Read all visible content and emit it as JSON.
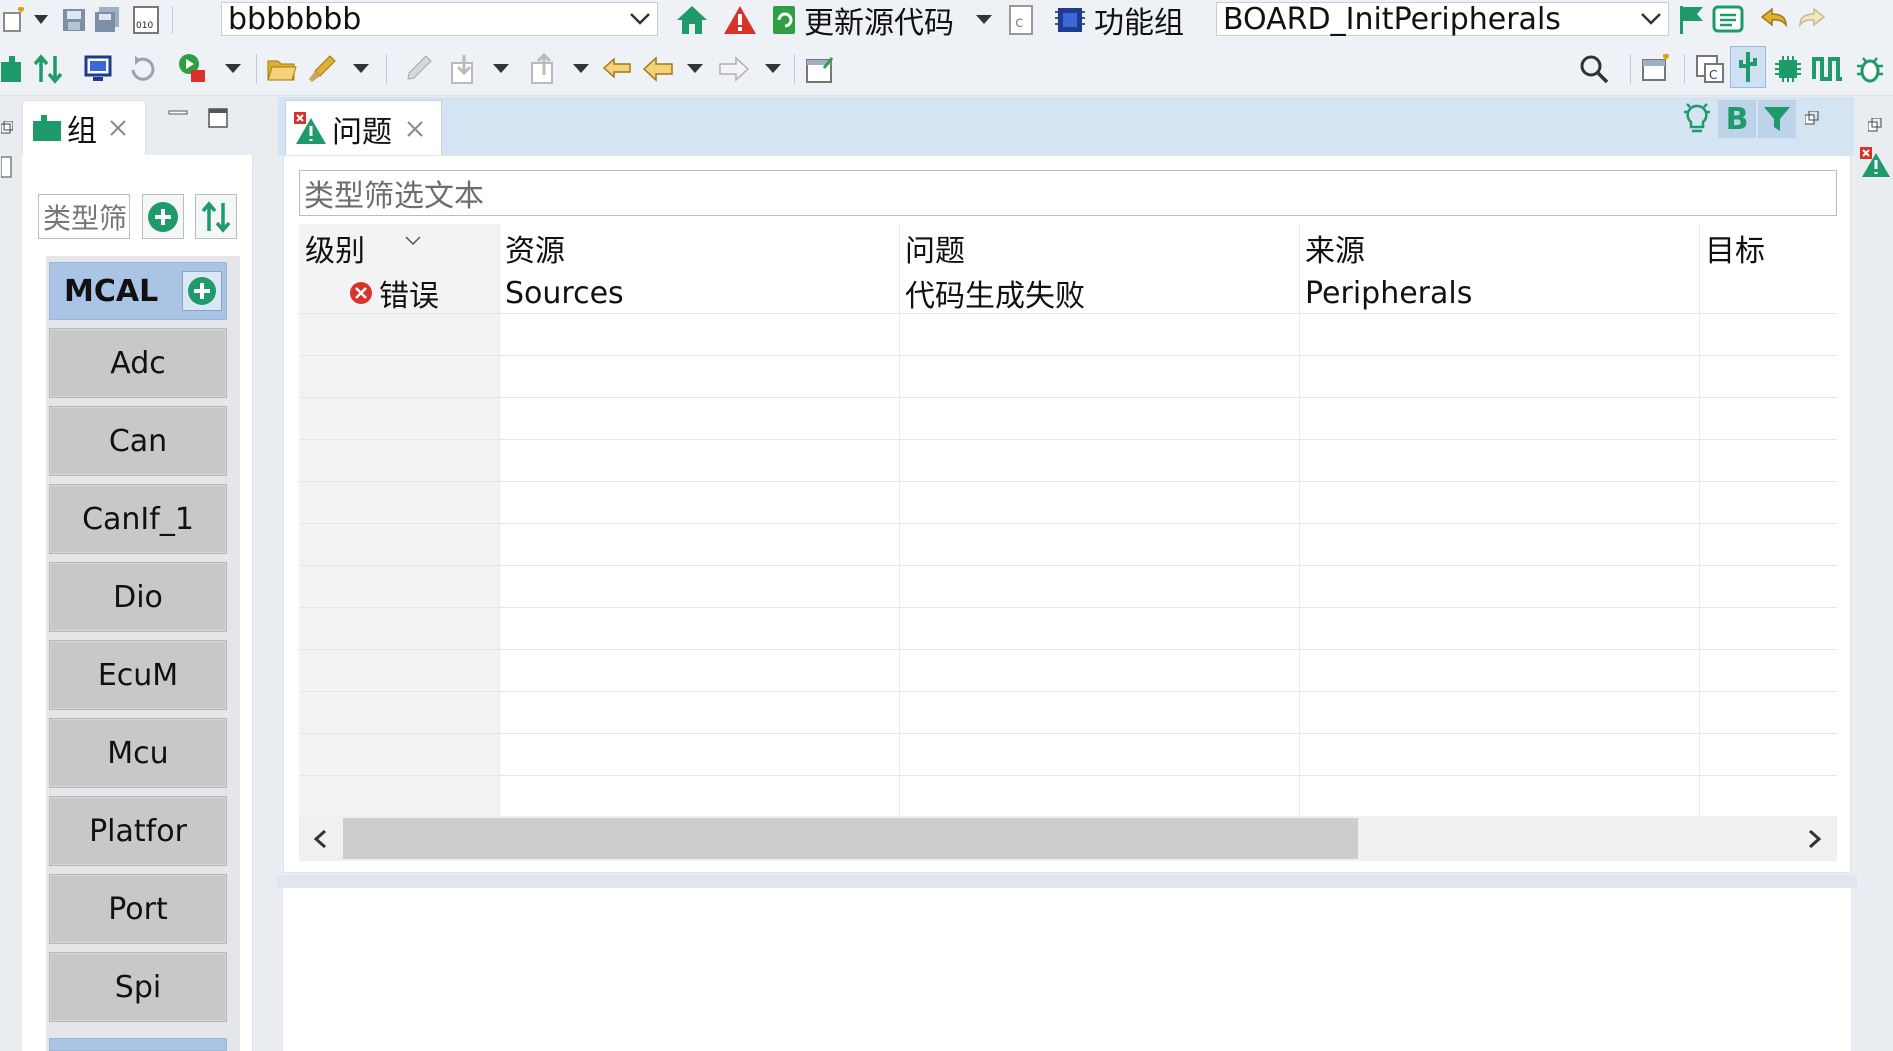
{
  "toolbar1": {
    "project_value": "bbbbbbb",
    "update_code_label": "更新源代码",
    "function_group_label": "功能组",
    "function_group_value": "BOARD_InitPeripherals"
  },
  "left_panel": {
    "tab_title": "组",
    "filter_placeholder": "类型筛",
    "category": "MCAL",
    "modules": [
      "Adc",
      "Can",
      "CanIf_1",
      "Dio",
      "EcuM",
      "Mcu",
      "Platfor",
      "Port",
      "Spi"
    ]
  },
  "problems_view": {
    "tab_title": "问题",
    "filter_placeholder": "类型筛选文本",
    "columns": [
      "级别",
      "资源",
      "问题",
      "来源",
      "目标"
    ],
    "rows": [
      {
        "level": "错误",
        "resource": "Sources",
        "problem": "代码生成失败",
        "origin": "Peripherals",
        "target": ""
      }
    ]
  },
  "colors": {
    "error_red": "#d9322b",
    "accent_green": "#1f9a6a",
    "selected_blue": "#a9c4e4",
    "tabbar_blue": "#d5e4f3"
  }
}
